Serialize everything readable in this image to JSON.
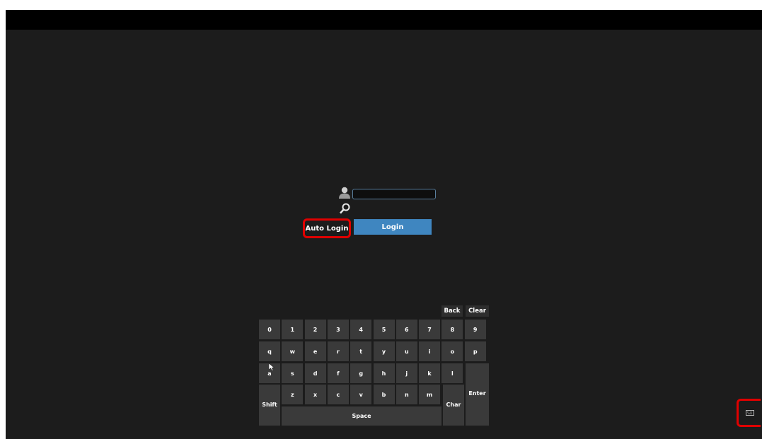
{
  "login": {
    "username_value": "",
    "auto_login_label": "Auto Login",
    "login_label": "Login"
  },
  "keyboard": {
    "back_label": "Back",
    "clear_label": "Clear",
    "row1": [
      "0",
      "1",
      "2",
      "3",
      "4",
      "5",
      "6",
      "7",
      "8",
      "9"
    ],
    "row2": [
      "q",
      "w",
      "e",
      "r",
      "t",
      "y",
      "u",
      "i",
      "o",
      "p"
    ],
    "row3": [
      "a",
      "s",
      "d",
      "f",
      "g",
      "h",
      "j",
      "k",
      "l"
    ],
    "row4": [
      "z",
      "x",
      "c",
      "v",
      "b",
      "n",
      "m"
    ],
    "shift_label": "Shift",
    "enter_label": "Enter",
    "char_label": "Char",
    "space_label": "Space"
  },
  "icons": {
    "user": "user-icon",
    "key": "key-icon",
    "cursor": "mouse-cursor-icon",
    "keyboard_toggle": "keyboard-icon"
  },
  "colors": {
    "background": "#1c1c1c",
    "login_button": "#3f86c0",
    "highlight": "#e00000",
    "key": "#3a3a3a"
  }
}
